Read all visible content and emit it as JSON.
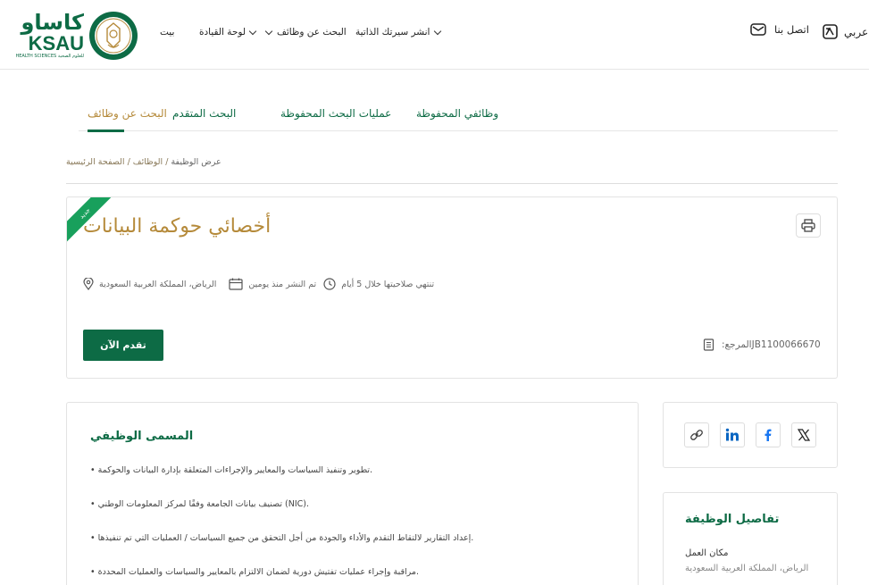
{
  "header": {
    "logo": {
      "arabic": "كاساو",
      "english": "KSAU",
      "subtitle": "HEALTH SCIENCES للعلوم الصحية"
    },
    "nav": {
      "home": "بيت",
      "dashboard": "لوحة القيادة",
      "job_search": "البحث عن وظائف",
      "post_resume": "انشر سيرتك الذاتية"
    },
    "contact_label": "اتصل بنا",
    "language_label": "عربي"
  },
  "tabs": {
    "saved_jobs": "وظائفي المحفوظة",
    "saved_searches": "عمليات البحث المحفوظة",
    "advanced_search": "البحث المتقدم",
    "job_search": "البحث عن وظائف"
  },
  "breadcrumb": {
    "home": "الصفحة الرئيسية",
    "sep1": " / ",
    "jobs": "الوظائف",
    "sep2": " / ",
    "current": "عرض الوظيفة"
  },
  "job": {
    "new_badge": "جديد",
    "title": "أخصائي حوكمة البيانات",
    "expires": "تنتهي صلاحيتها خلال 5 أيام",
    "posted": "تم النشر منذ يومين",
    "location": "الرياض، المملكة العربية السعودية",
    "apply_label": "تقدم الآن",
    "reference_label": "المرجع:",
    "reference_value": "JB1100066670"
  },
  "description": {
    "title": "المسمى الوظيفي",
    "bullets": [
      "• تطوير وتنفيذ السياسات والمعايير والإجراءات المتعلقة بإدارة البيانات والحوكمة.",
      "• تصنيف بيانات الجامعة وفقًا لمركز المعلومات الوطني (NIC).",
      "• إعداد التقارير لالتقاط التقدم والأداء والجودة من أجل التحقق من جميع السياسات / العمليات التي تم تنفيذها.",
      "• مراقبة وإجراء عمليات تفتيش دورية لضمان الالتزام بالمعايير والسياسات والعمليات المحددة."
    ]
  },
  "details": {
    "title": "تفاصيل الوظيفة",
    "location_label": "مكان العمل",
    "location_value": "الرياض، المملكة العربية السعودية"
  },
  "colors": {
    "brand_green": "#0d6b45",
    "gold": "#b58a3a",
    "badge_green": "#18a05c"
  }
}
